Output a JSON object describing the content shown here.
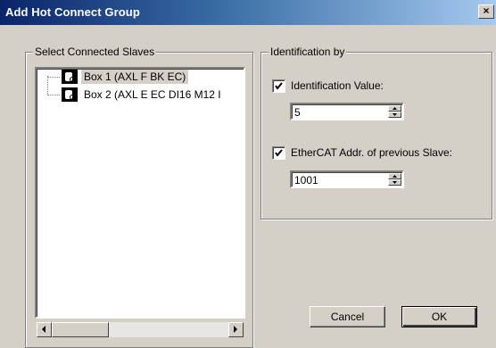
{
  "window": {
    "title": "Add Hot Connect Group",
    "close_label": "×"
  },
  "left_group": {
    "label": "Select Connected Slaves",
    "tree_items": [
      {
        "label": "Box 1 (AXL F BK EC)",
        "selected": true
      },
      {
        "label": "Box 2 (AXL E EC DI16 M12 I",
        "selected": false
      }
    ]
  },
  "right_group": {
    "label": "Identification by",
    "identification_value": {
      "checkbox_label": "Identification Value:",
      "checked": true,
      "value": "5"
    },
    "ethercat_addr": {
      "checkbox_label": "EtherCAT Addr. of previous Slave:",
      "checked": true,
      "value": "1001"
    }
  },
  "buttons": {
    "cancel": "Cancel",
    "ok": "OK"
  }
}
